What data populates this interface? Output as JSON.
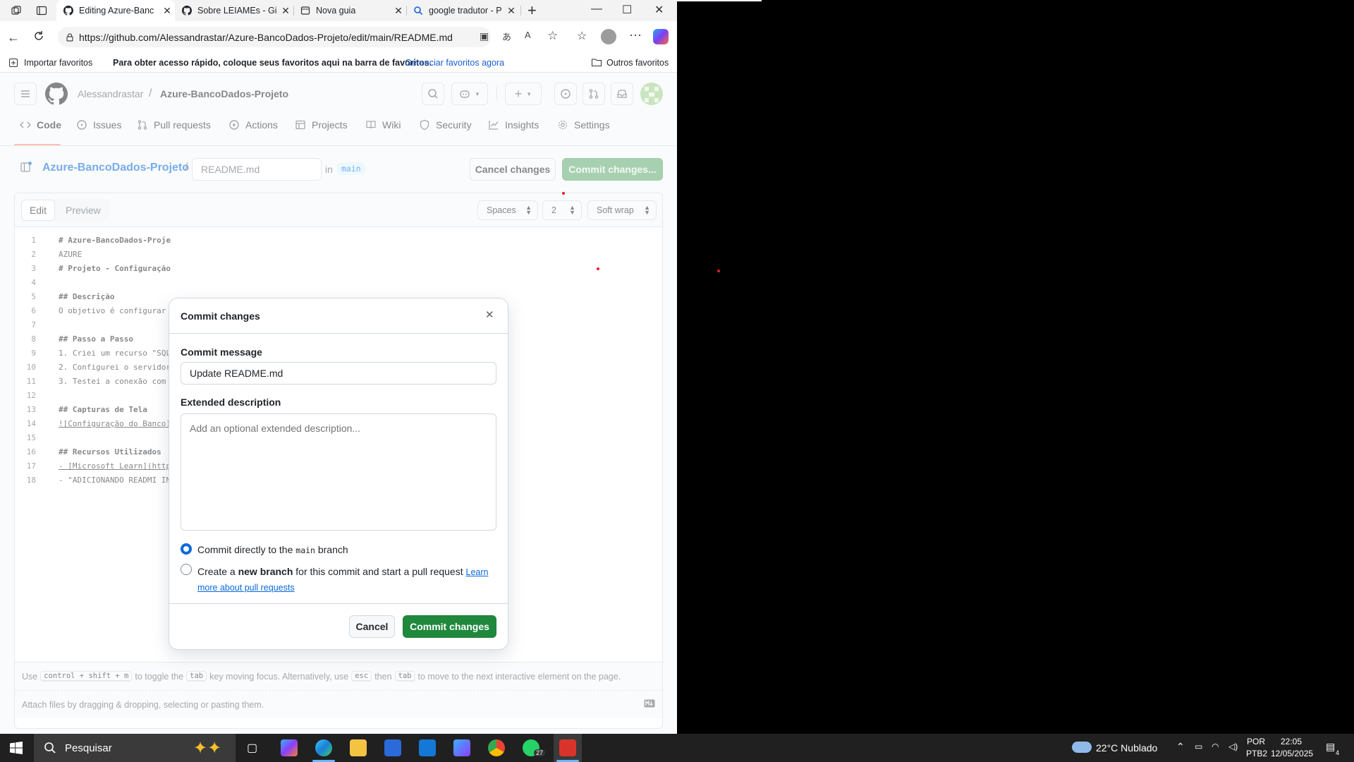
{
  "browser": {
    "tabs": [
      {
        "title": "Editing Azure-Banc",
        "active": true,
        "icon": "github-icon"
      },
      {
        "title": "Sobre LEIAMEs - Gi",
        "active": false,
        "icon": "github-icon"
      },
      {
        "title": "Nova guia",
        "active": false,
        "icon": "new-tab-icon"
      },
      {
        "title": "google tradutor - P",
        "active": false,
        "icon": "search-icon"
      }
    ],
    "url": "https://github.com/Alessandrastar/Azure-BancoDados-Projeto/edit/main/README.md",
    "favorites_bar": {
      "import": "Importar favoritos",
      "hint": "Para obter acesso rápido, coloque seus favoritos aqui na barra de favoritos.",
      "manage": "Gerenciar favoritos agora",
      "other": "Outros favoritos"
    }
  },
  "github": {
    "owner": "Alessandrastar",
    "separator": "/",
    "repo": "Azure-BancoDados-Projeto",
    "nav": [
      {
        "label": "Code",
        "icon": "code-icon"
      },
      {
        "label": "Issues",
        "icon": "issue-icon"
      },
      {
        "label": "Pull requests",
        "icon": "pull-request-icon"
      },
      {
        "label": "Actions",
        "icon": "play-icon"
      },
      {
        "label": "Projects",
        "icon": "table-icon"
      },
      {
        "label": "Wiki",
        "icon": "book-icon"
      },
      {
        "label": "Security",
        "icon": "shield-icon"
      },
      {
        "label": "Insights",
        "icon": "graph-icon"
      },
      {
        "label": "Settings",
        "icon": "gear-icon"
      }
    ],
    "editbar": {
      "repo_link": "Azure-BancoDados-Projeto",
      "slash": "/",
      "filename": "README.md",
      "in": "in",
      "branch": "main",
      "cancel": "Cancel changes",
      "commit": "Commit changes..."
    },
    "editor": {
      "tab_edit": "Edit",
      "tab_preview": "Preview",
      "indent_mode": "Spaces",
      "indent_size": "2",
      "wrap": "Soft wrap",
      "lines": [
        "# Azure-BancoDados-Proje",
        "AZURE",
        "# Projeto - Configuração",
        "",
        "## Descrição",
        "O objetivo é configurar",
        "",
        "## Passo a Passo",
        "1. Criei um recurso \"SQL",
        "2. Configurei o servidor",
        "3. Testei a conexão com",
        "",
        "## Capturas de Tela",
        "![Configuração do Banco]",
        "",
        "## Recursos Utilizados",
        "- [Microsoft Learn](http",
        "- \"ADICIONANDO READMI IN"
      ],
      "footer_hint": {
        "use": "Use",
        "k1": "control + shift + m",
        "t1": "to toggle the",
        "k2": "tab",
        "t2": "key moving focus. Alternatively, use",
        "k3": "esc",
        "t3": "then",
        "k4": "tab",
        "t4": "to move to the next interactive element on the page."
      },
      "attach": "Attach files by dragging & dropping, selecting or pasting them."
    }
  },
  "dialog": {
    "title": "Commit changes",
    "msg_label": "Commit message",
    "msg_value": "Update README.md",
    "desc_label": "Extended description",
    "desc_placeholder": "Add an optional extended description...",
    "opt1_a": "Commit directly to the",
    "opt1_branch": "main",
    "opt1_b": "branch",
    "opt2_a": "Create a",
    "opt2_bold": "new branch",
    "opt2_b": "for this commit and start a pull request",
    "opt2_link_a": "Learn",
    "opt2_link_b": "more about pull requests",
    "cancel": "Cancel",
    "commit": "Commit changes"
  },
  "taskbar": {
    "search": "Pesquisar",
    "weather": "22°C  Nublado",
    "lang1": "POR",
    "lang2": "PTB2",
    "time": "22:05",
    "date": "12/05/2025",
    "whatsapp_badge": "27",
    "notif": "4"
  },
  "colors": {
    "primary": "#1f883d",
    "accent": "#0969da",
    "nav_underline": "#fd8c73"
  }
}
